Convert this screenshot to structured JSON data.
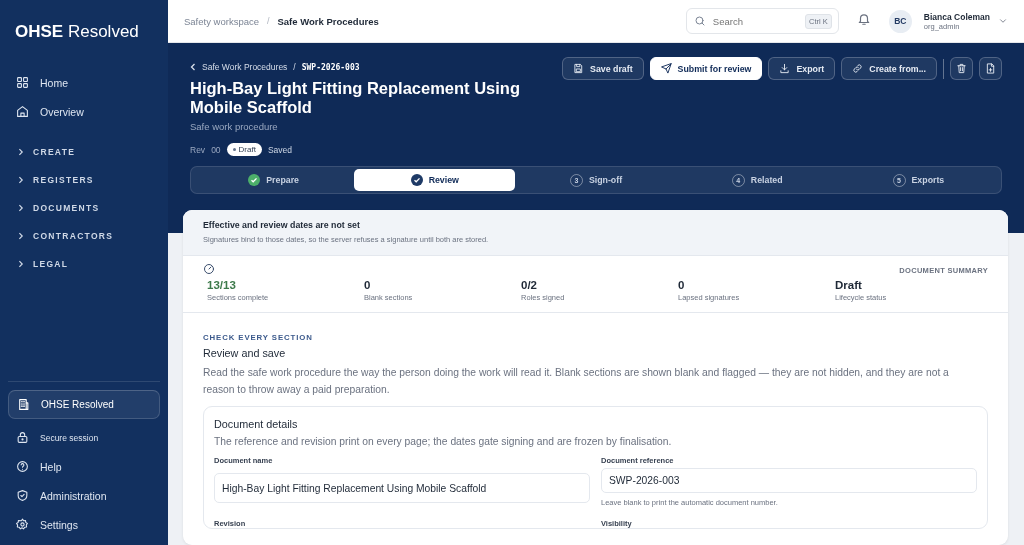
{
  "sidebar": {
    "logo": {
      "strong": "OHSE",
      "light": "Resolved"
    },
    "items": [
      {
        "label": "Home"
      },
      {
        "label": "Overview"
      }
    ],
    "groups": [
      {
        "label": "CREATE",
        "expanded": false
      },
      {
        "label": "REGISTERS",
        "expanded": false
      },
      {
        "label": "DOCUMENTS",
        "expanded": false
      },
      {
        "label": "CONTRACTORS",
        "expanded": false
      },
      {
        "label": "LEGAL",
        "expanded": false
      }
    ],
    "org": {
      "label": "OHSE Resolved"
    },
    "session": {
      "label": "Secure session"
    },
    "footer_items": [
      {
        "label": "Help"
      },
      {
        "label": "Administration"
      },
      {
        "label": "Settings"
      }
    ]
  },
  "topbar": {
    "breadcrumb": [
      "Safety workspace",
      "Safe Work Procedures"
    ],
    "separator": "/",
    "search": {
      "placeholder": "Search",
      "shortcut": "Ctrl K"
    },
    "user": {
      "initials": "BC",
      "name": "Bianca Coleman",
      "role": "org_admin"
    }
  },
  "header": {
    "back": "Safe Work Procedures",
    "separator": "/",
    "reference": "SWP-2026-003",
    "title": "High-Bay Light Fitting Replacement Using Mobile Scaffold",
    "subtitle": "Safe work procedure",
    "revision_label": "Rev",
    "revision": "00",
    "status": "Draft",
    "save_state": "Saved",
    "actions": [
      {
        "label": "Save draft",
        "primary": false
      },
      {
        "label": "Submit for review",
        "primary": true
      },
      {
        "label": "Export",
        "primary": false
      },
      {
        "label": "Create from...",
        "primary": false
      }
    ]
  },
  "steps": [
    {
      "label": "Prepare",
      "selected": false
    },
    {
      "label": "Review",
      "selected": true
    },
    {
      "label": "Sign-off",
      "number": "3",
      "selected": false
    },
    {
      "label": "Related",
      "number": "4",
      "selected": false
    },
    {
      "label": "Exports",
      "number": "5",
      "selected": false
    }
  ],
  "alert": {
    "title": "Effective and review dates are not set",
    "text": "Signatures bind to those dates, so the server refuses a signature until both are stored."
  },
  "summary": {
    "title": "DOCUMENT SUMMARY",
    "stats": [
      {
        "value": "13/13",
        "label": "Sections complete",
        "color": "#3d7a4b"
      },
      {
        "value": "0",
        "label": "Blank sections",
        "color": "#1f2937"
      },
      {
        "value": "0/2",
        "label": "Roles signed",
        "color": "#1f2937"
      },
      {
        "value": "0",
        "label": "Lapsed signatures",
        "color": "#1f2937"
      },
      {
        "value": "Draft",
        "label": "Lifecycle status",
        "color": "#1f2937"
      }
    ]
  },
  "section": {
    "eyebrow": "CHECK EVERY SECTION",
    "title": "Review and save",
    "text": "Read the safe work procedure the way the person doing the work will read it. Blank sections are shown blank and flagged — they are not hidden, and they are not a reason to throw away a paid preparation."
  },
  "details": {
    "title": "Document details",
    "text": "The reference and revision print on every page; the dates gate signing and are frozen by finalisation.",
    "fields": [
      {
        "label": "Document name",
        "value": "High-Bay Light Fitting Replacement Using Mobile Scaffold"
      },
      {
        "label": "Document reference",
        "value": "SWP-2026-003",
        "hint": "Leave blank to print the automatic document number."
      },
      {
        "label": "Revision"
      },
      {
        "label": "Visibility"
      }
    ]
  }
}
